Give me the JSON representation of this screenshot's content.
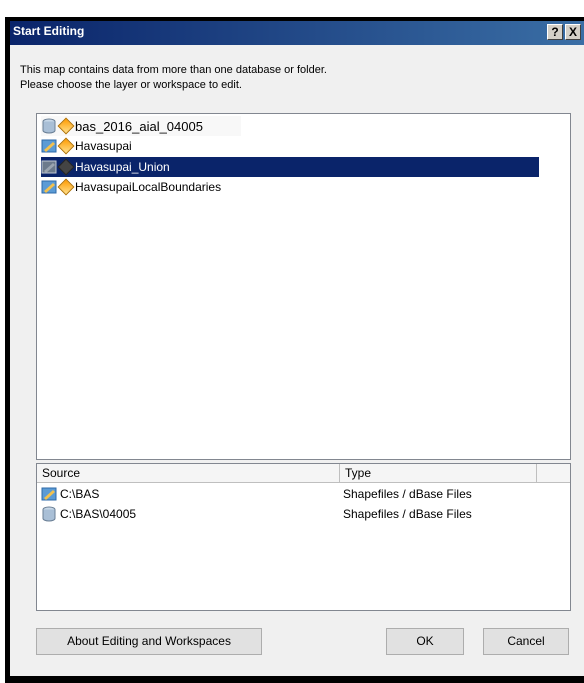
{
  "title": "Start Editing",
  "title_buttons": {
    "help": "?",
    "close": "X"
  },
  "intro_line1": "This map contains data from more than one database or folder.",
  "intro_line2": "Please choose the layer or workspace to edit.",
  "layers": [
    {
      "label": "bas_2016_aial_04005",
      "icon": "database-icon",
      "selected": false
    },
    {
      "label": "Havasupai",
      "icon": "shapefile-folder-icon",
      "selected": false
    },
    {
      "label": "Havasupai_Union",
      "icon": "shapefile-folder-icon",
      "selected": true
    },
    {
      "label": "HavasupaiLocalBoundaries",
      "icon": "shapefile-folder-icon",
      "selected": false
    }
  ],
  "columns": {
    "source": "Source",
    "type": "Type"
  },
  "sources": [
    {
      "source": "C:\\BAS",
      "type": "Shapefiles / dBase Files",
      "icon": "shapefile-folder-icon"
    },
    {
      "source": "C:\\BAS\\04005",
      "type": "Shapefiles / dBase Files",
      "icon": "database-icon"
    }
  ],
  "buttons": {
    "about": "About Editing and Workspaces",
    "ok": "OK",
    "cancel": "Cancel"
  },
  "colors": {
    "selection": "#0a246a",
    "titlebar": "#0a246a"
  }
}
